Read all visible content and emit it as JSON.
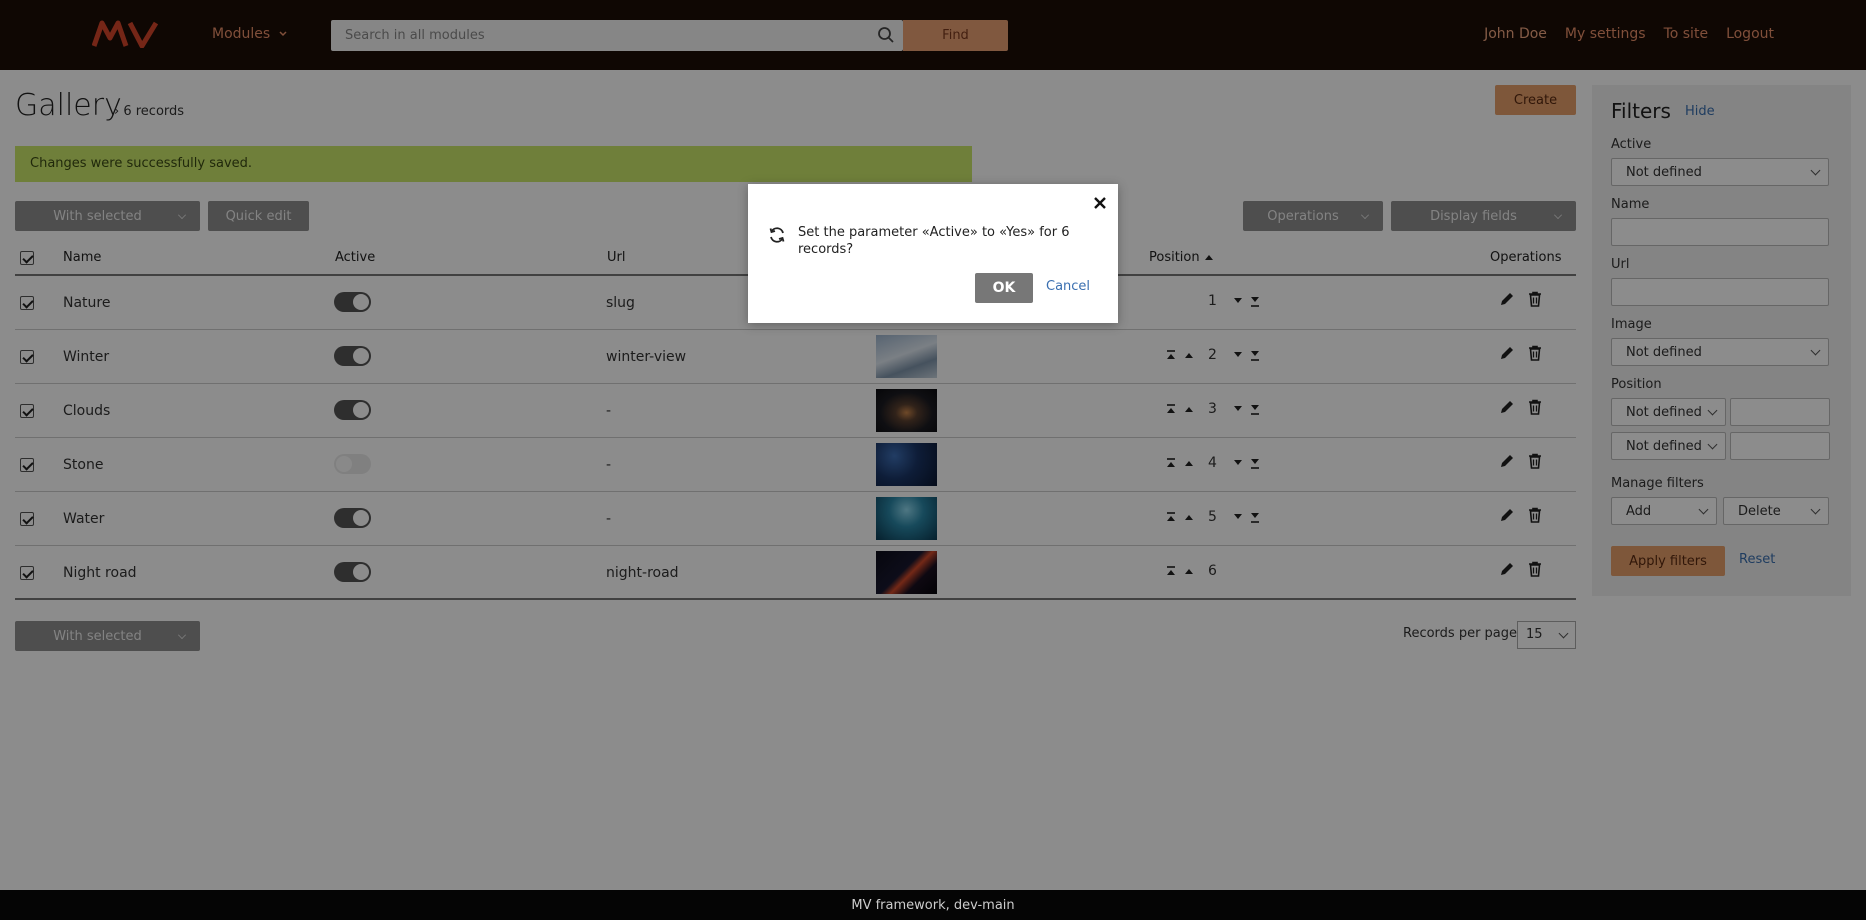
{
  "header": {
    "logo_text": "MV",
    "modules_label": "Modules",
    "search_placeholder": "Search in all modules",
    "find_label": "Find",
    "user_name": "John Doe",
    "my_settings": "My settings",
    "to_site": "To site",
    "logout": "Logout"
  },
  "page": {
    "title": "Gallery",
    "records_count": "6 records",
    "create_label": "Create",
    "flash_message": "Changes were successfully saved."
  },
  "toolbar": {
    "with_selected": "With selected",
    "quick_edit": "Quick edit",
    "operations": "Operations",
    "display_fields": "Display fields"
  },
  "table": {
    "columns": {
      "name": "Name",
      "active": "Active",
      "url": "Url",
      "position": "Position",
      "operations": "Operations"
    },
    "rows": [
      {
        "name": "Nature",
        "active": true,
        "url": "slug",
        "position": "1",
        "image": ""
      },
      {
        "name": "Winter",
        "active": true,
        "url": "winter-view",
        "position": "2",
        "image": "snow-mountains"
      },
      {
        "name": "Clouds",
        "active": true,
        "url": "-",
        "position": "3",
        "image": "dark-clouds"
      },
      {
        "name": "Stone",
        "active": false,
        "url": "-",
        "position": "4",
        "image": "night-stone-arch"
      },
      {
        "name": "Water",
        "active": true,
        "url": "-",
        "position": "5",
        "image": "underwater"
      },
      {
        "name": "Night road",
        "active": true,
        "url": "night-road",
        "position": "6",
        "image": "night-road"
      }
    ]
  },
  "bottom": {
    "with_selected": "With selected",
    "records_per_page_label": "Records per page",
    "records_per_page": "15"
  },
  "filters": {
    "title": "Filters",
    "hide": "Hide",
    "active_label": "Active",
    "active_value": "Not defined",
    "name_label": "Name",
    "url_label": "Url",
    "image_label": "Image",
    "image_value": "Not defined",
    "position_label": "Position",
    "position_cond_1": "Not defined",
    "position_cond_2": "Not defined",
    "manage_label": "Manage filters",
    "add": "Add",
    "delete": "Delete",
    "apply": "Apply filters",
    "reset": "Reset"
  },
  "modal": {
    "message": "Set the parameter «Active» to «Yes» for 6 records?",
    "ok": "OK",
    "cancel": "Cancel"
  },
  "footer": {
    "text": "MV framework, dev-main"
  },
  "colors": {
    "header_bg": "#1c0d06",
    "accent": "#e59f6a",
    "link": "#3a6fb0",
    "flash_bg": "#cbe86b"
  }
}
